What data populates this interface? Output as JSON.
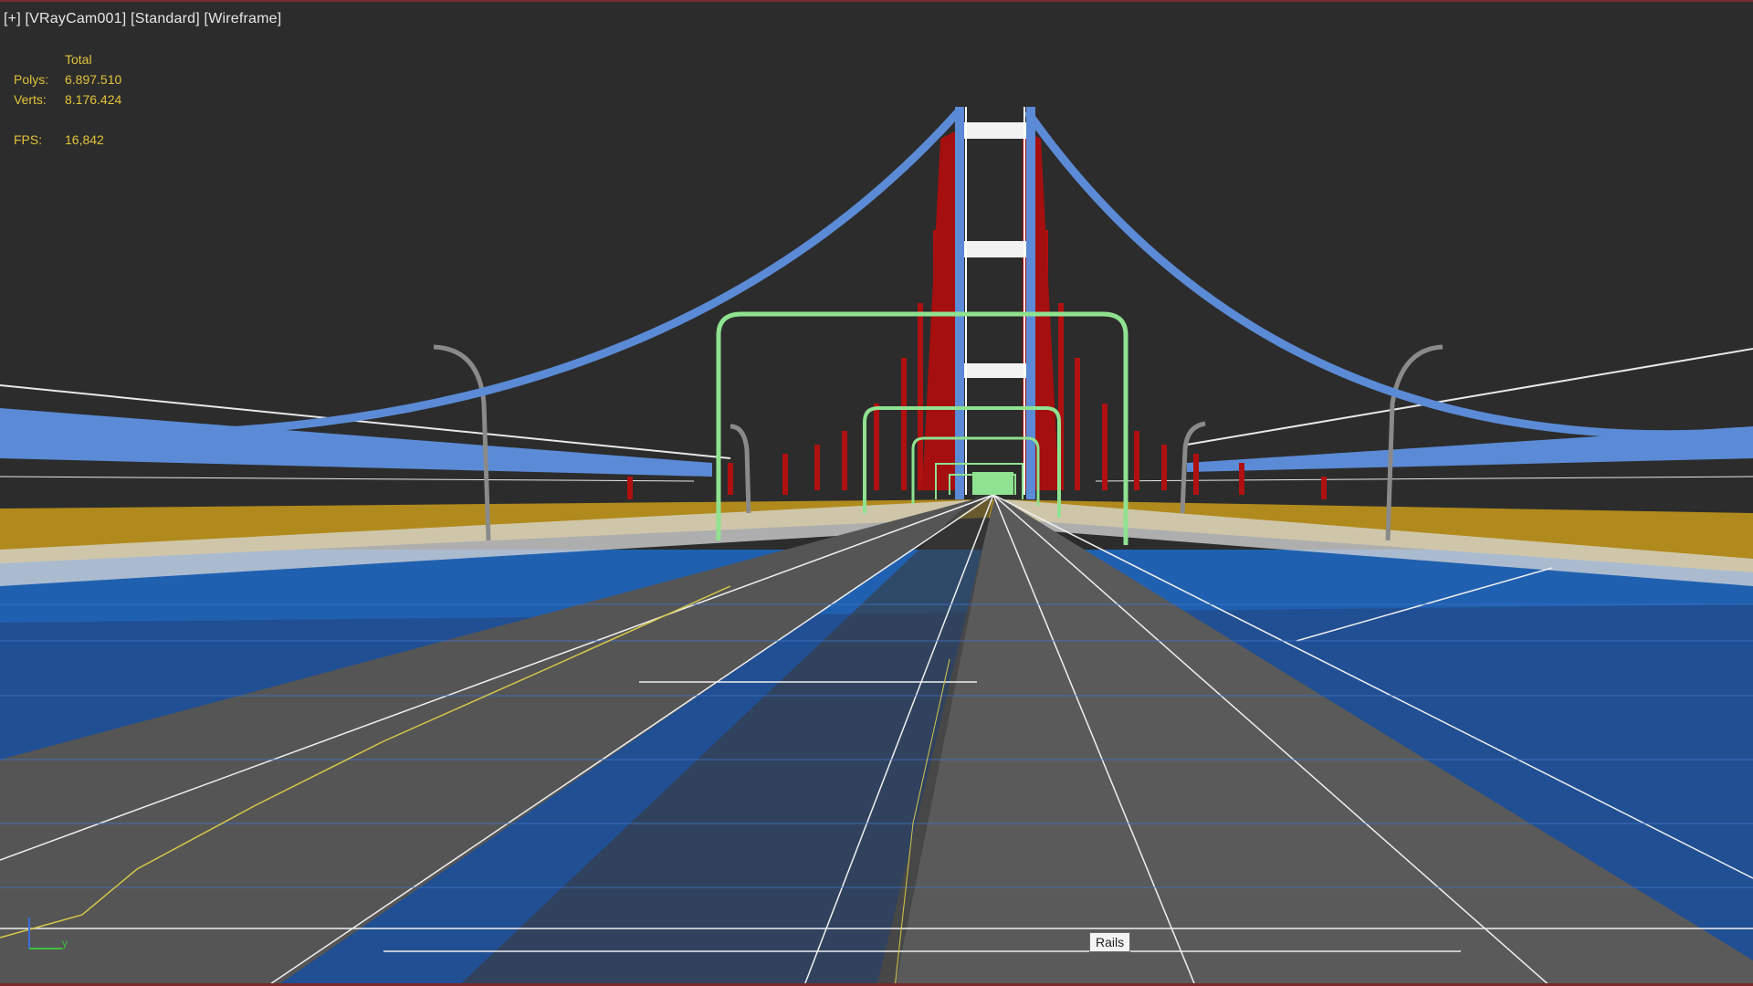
{
  "viewport": {
    "label_parts": [
      "[+]",
      "[VRayCam001]",
      "[Standard]",
      "[Wireframe]"
    ]
  },
  "stats": {
    "header": "Total",
    "rows": [
      {
        "key": "Polys:",
        "value": "6.897.510"
      },
      {
        "key": "Verts:",
        "value": "8.176.424"
      }
    ],
    "fps_key": "FPS:",
    "fps_value": "16,842"
  },
  "tooltip": "Rails",
  "gizmo": {
    "y_label": "y"
  },
  "colors": {
    "background": "#2c2c2c",
    "stats_text": "#e2c23a",
    "tower_cables": "#5b8bd6",
    "hangers": "#b01010",
    "water": "#1e56a8",
    "shore": "#b08a1c",
    "arches": "#8fe28f",
    "road": "#5a5a5a",
    "frame_border": "#7a2a2a"
  },
  "icons": [
    "axis-gizmo-icon"
  ]
}
